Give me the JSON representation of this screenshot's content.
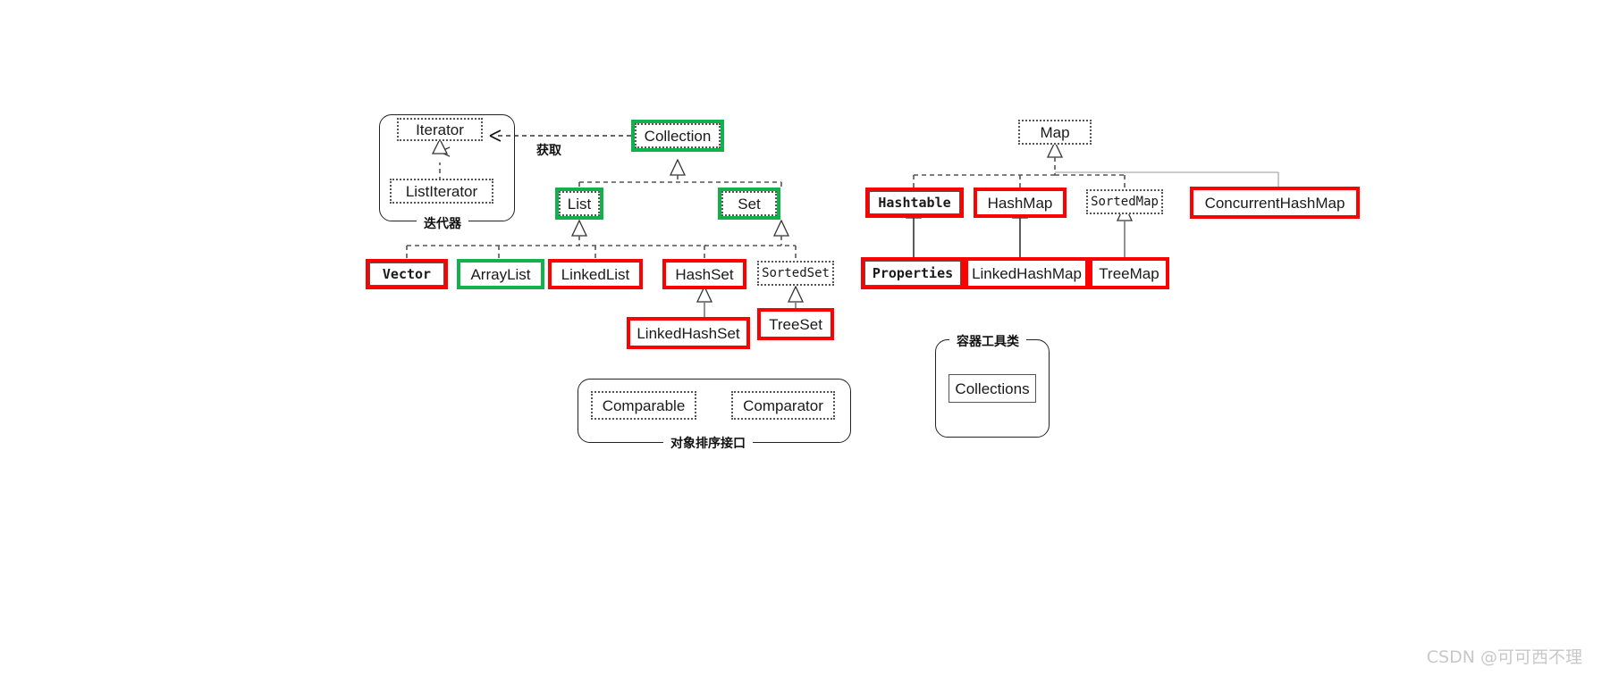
{
  "diagram": {
    "title": "Java Collections Framework hierarchy",
    "colors": {
      "highlight_red": "#ff0000",
      "highlight_green": "#12b24a",
      "line": "#555555",
      "line_light": "#999999",
      "text": "#1a1a1a",
      "watermark": "#c8c8c8"
    },
    "groups": [
      {
        "id": "iterator_group",
        "label": "迭代器",
        "label_pos": "bottom"
      },
      {
        "id": "sorting_group",
        "label": "对象排序接口",
        "label_pos": "bottom"
      },
      {
        "id": "collections_group",
        "label": "容器工具类",
        "label_pos": "top"
      }
    ],
    "edge_labels": [
      {
        "id": "obtain",
        "text": "获取"
      }
    ],
    "nodes": [
      {
        "id": "iterator",
        "label": "Iterator",
        "kind": "interface",
        "highlight": "none",
        "font": "sans"
      },
      {
        "id": "listiterator",
        "label": "ListIterator",
        "kind": "interface",
        "highlight": "none",
        "font": "sans"
      },
      {
        "id": "collection",
        "label": "Collection",
        "kind": "interface",
        "highlight": "green",
        "font": "sans"
      },
      {
        "id": "list",
        "label": "List",
        "kind": "interface",
        "highlight": "green",
        "font": "sans"
      },
      {
        "id": "set",
        "label": "Set",
        "kind": "interface",
        "highlight": "green",
        "font": "sans"
      },
      {
        "id": "vector",
        "label": "Vector",
        "kind": "class",
        "highlight": "red",
        "font": "mono"
      },
      {
        "id": "arraylist",
        "label": "ArrayList",
        "kind": "class",
        "highlight": "green",
        "font": "sans"
      },
      {
        "id": "linkedlist",
        "label": "LinkedList",
        "kind": "class",
        "highlight": "red",
        "font": "sans"
      },
      {
        "id": "hashset",
        "label": "HashSet",
        "kind": "class",
        "highlight": "red",
        "font": "sans"
      },
      {
        "id": "sortedset",
        "label": "SortedSet",
        "kind": "interface",
        "highlight": "none",
        "font": "mono-light"
      },
      {
        "id": "linkedhashset",
        "label": "LinkedHashSet",
        "kind": "class",
        "highlight": "red",
        "font": "sans"
      },
      {
        "id": "treeset",
        "label": "TreeSet",
        "kind": "class",
        "highlight": "red",
        "font": "sans"
      },
      {
        "id": "map",
        "label": "Map",
        "kind": "interface",
        "highlight": "none",
        "font": "sans"
      },
      {
        "id": "hashtable",
        "label": "Hashtable",
        "kind": "class",
        "highlight": "red",
        "font": "mono"
      },
      {
        "id": "hashmap",
        "label": "HashMap",
        "kind": "class",
        "highlight": "red",
        "font": "sans"
      },
      {
        "id": "sortedmap",
        "label": "SortedMap",
        "kind": "interface",
        "highlight": "none",
        "font": "mono-light"
      },
      {
        "id": "concurrenthashmap",
        "label": "ConcurrentHashMap",
        "kind": "class",
        "highlight": "red",
        "font": "sans"
      },
      {
        "id": "properties",
        "label": "Properties",
        "kind": "class",
        "highlight": "red",
        "font": "mono"
      },
      {
        "id": "linkedhashmap",
        "label": "LinkedHashMap",
        "kind": "class",
        "highlight": "red",
        "font": "sans"
      },
      {
        "id": "treemap",
        "label": "TreeMap",
        "kind": "class",
        "highlight": "red",
        "font": "sans"
      },
      {
        "id": "comparable",
        "label": "Comparable",
        "kind": "interface",
        "highlight": "none",
        "font": "sans"
      },
      {
        "id": "comparator",
        "label": "Comparator",
        "kind": "interface",
        "highlight": "none",
        "font": "sans"
      },
      {
        "id": "collections",
        "label": "Collections",
        "kind": "class",
        "highlight": "none",
        "font": "sans"
      }
    ],
    "edges": [
      {
        "from": "listiterator",
        "to": "iterator",
        "style": "dashed",
        "arrow": "hollow-triangle"
      },
      {
        "from": "collection",
        "to": "iterator",
        "style": "dashed",
        "arrow": "open",
        "label": "获取"
      },
      {
        "from": "list",
        "to": "collection",
        "style": "dashed",
        "arrow": "hollow-triangle"
      },
      {
        "from": "set",
        "to": "collection",
        "style": "dashed",
        "arrow": "hollow-triangle"
      },
      {
        "from": "vector",
        "to": "list",
        "style": "dashed",
        "arrow": "hollow-triangle"
      },
      {
        "from": "arraylist",
        "to": "list",
        "style": "dashed",
        "arrow": "hollow-triangle"
      },
      {
        "from": "linkedlist",
        "to": "list",
        "style": "dashed",
        "arrow": "hollow-triangle"
      },
      {
        "from": "hashset",
        "to": "set",
        "style": "dashed",
        "arrow": "hollow-triangle"
      },
      {
        "from": "sortedset",
        "to": "set",
        "style": "dashed",
        "arrow": "hollow-triangle"
      },
      {
        "from": "linkedhashset",
        "to": "hashset",
        "style": "solid",
        "arrow": "hollow-triangle"
      },
      {
        "from": "treeset",
        "to": "sortedset",
        "style": "solid",
        "arrow": "hollow-triangle"
      },
      {
        "from": "hashtable",
        "to": "map",
        "style": "dashed",
        "arrow": "hollow-triangle"
      },
      {
        "from": "hashmap",
        "to": "map",
        "style": "dashed",
        "arrow": "hollow-triangle"
      },
      {
        "from": "sortedmap",
        "to": "map",
        "style": "dashed",
        "arrow": "hollow-triangle"
      },
      {
        "from": "concurrenthashmap",
        "to": "map",
        "style": "solid",
        "arrow": "hollow-triangle"
      },
      {
        "from": "properties",
        "to": "hashtable",
        "style": "solid",
        "arrow": "hollow-triangle"
      },
      {
        "from": "linkedhashmap",
        "to": "hashmap",
        "style": "solid",
        "arrow": "hollow-triangle"
      },
      {
        "from": "treemap",
        "to": "sortedmap",
        "style": "solid",
        "arrow": "hollow-triangle"
      }
    ]
  },
  "watermark": {
    "text": "CSDN @可可西不理"
  }
}
